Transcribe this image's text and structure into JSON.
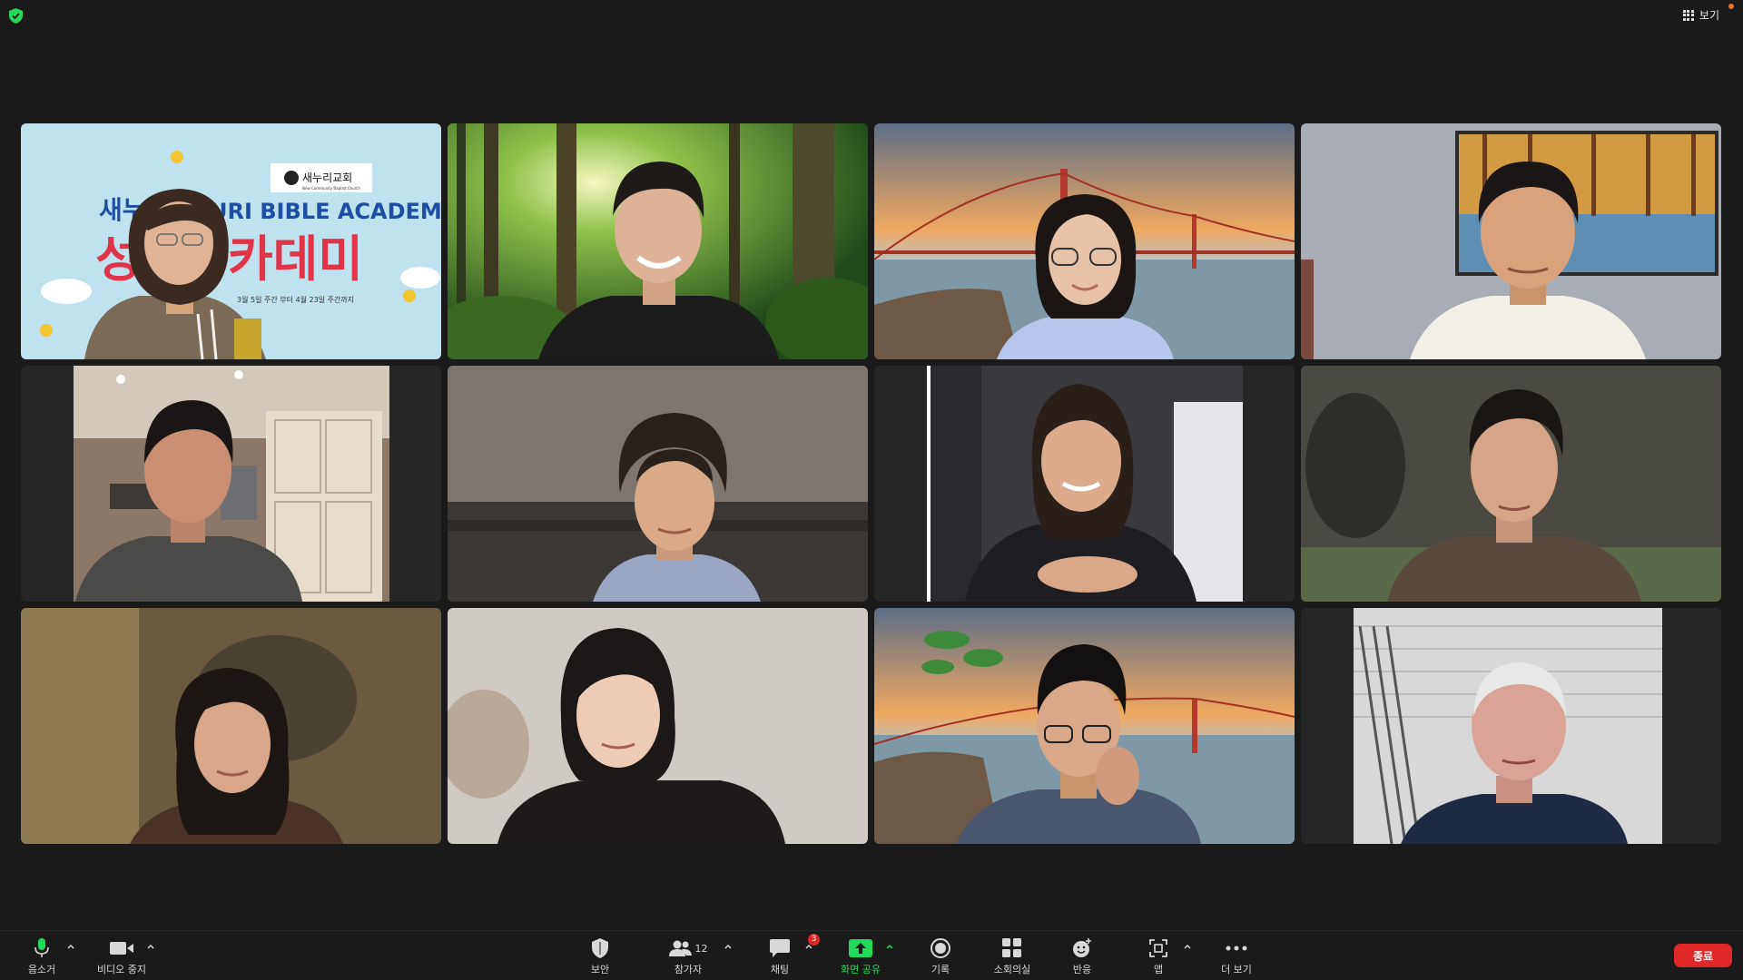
{
  "topbar": {
    "view_label": "보기",
    "shield_color": "#23d959",
    "notice_dot_color": "#f2711c"
  },
  "gallery": {
    "active_speaker_border": "#23d959",
    "tiles": [
      {
        "background": "Nuri Bible Academy slide",
        "slide": {
          "church_logo_text": "새누리교회",
          "church_logo_subtext": "New Community Baptist Church",
          "title_left_1": "새누리",
          "title_right_1": "URI BIBLE ACADEMY",
          "title_left_2": "성",
          "title_right_2": "카데미",
          "date_text": "3월 5일 주간 부터 4월 23일 주간까지"
        }
      },
      {
        "background": "forest",
        "active_speaker": true
      },
      {
        "background": "golden gate bridge sunset"
      },
      {
        "background": "living room with painting"
      },
      {
        "background": "kitchen"
      },
      {
        "background": "living room couch"
      },
      {
        "background": "dark room"
      },
      {
        "background": "blurred room"
      },
      {
        "background": "warm blurred room"
      },
      {
        "background": "light blurred room"
      },
      {
        "background": "golden gate bridge sunset with leaves"
      },
      {
        "background": "white slatted wall"
      }
    ]
  },
  "toolbar": {
    "mute": {
      "label": "음소거",
      "icon": "microphone-icon"
    },
    "video": {
      "label": "비디오 중지",
      "icon": "video-camera-icon"
    },
    "security": {
      "label": "보안",
      "icon": "shield-icon"
    },
    "participants": {
      "label": "참가자",
      "count": "12",
      "icon": "participants-icon"
    },
    "chat": {
      "label": "채팅",
      "badge": "3",
      "icon": "chat-icon"
    },
    "share": {
      "label": "화면 공유",
      "icon": "share-screen-icon",
      "color": "#23d959"
    },
    "record": {
      "label": "기록",
      "icon": "record-icon"
    },
    "breakout": {
      "label": "소회의실",
      "icon": "breakout-rooms-icon"
    },
    "reactions": {
      "label": "반응",
      "icon": "reaction-icon"
    },
    "apps": {
      "label": "앱",
      "icon": "apps-icon"
    },
    "more": {
      "label": "더 보기",
      "icon": "more-icon"
    },
    "end": {
      "label": "종료",
      "color": "#e02828"
    }
  }
}
